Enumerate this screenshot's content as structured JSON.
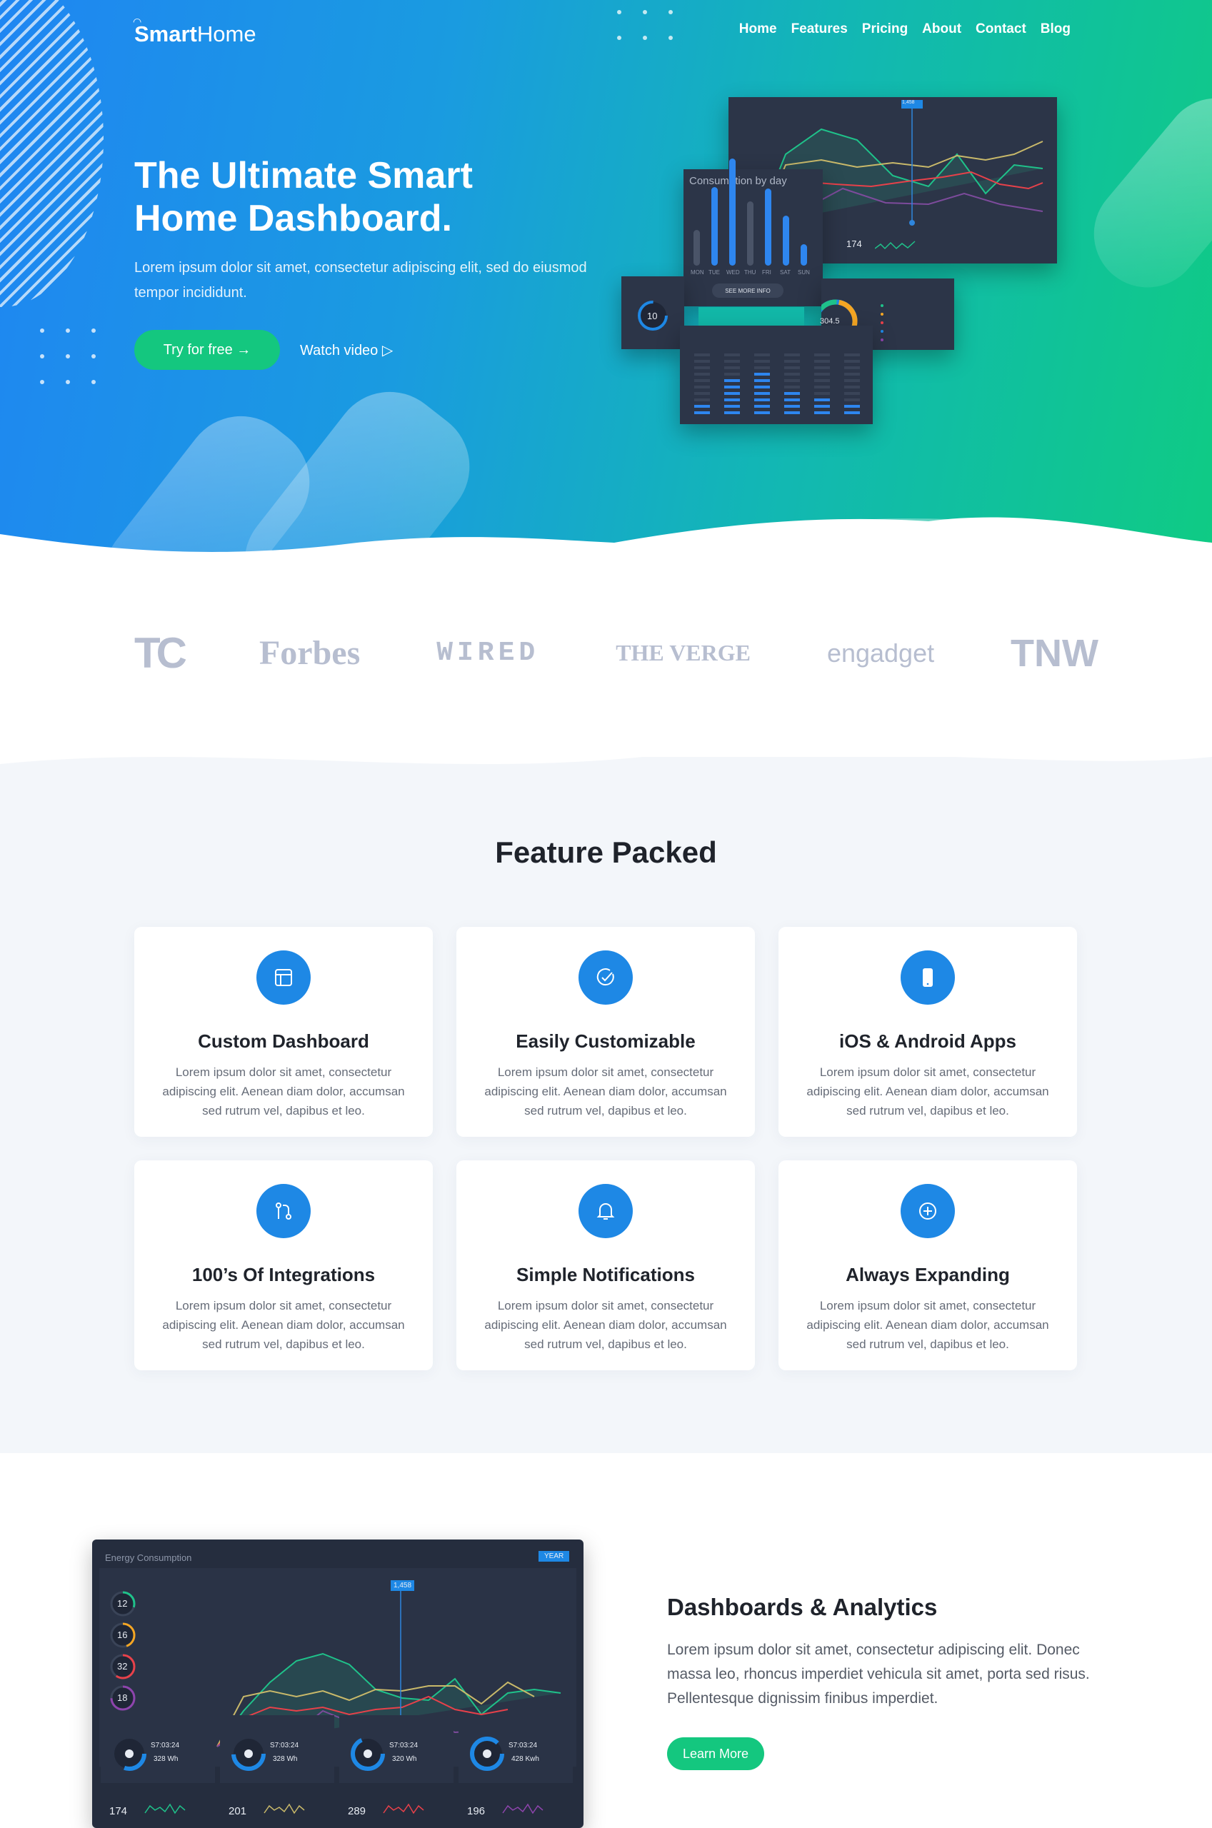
{
  "brand": {
    "bold": "Smart",
    "light": "Home"
  },
  "nav": [
    "Home",
    "Features",
    "Pricing",
    "About",
    "Contact",
    "Blog"
  ],
  "hero": {
    "title_line1": "The Ultimate Smart",
    "title_line2": "Home Dashboard.",
    "subtitle": "Lorem ipsum dolor sit amet, consectetur adipiscing elit, sed do eiusmod tempor incididunt.",
    "cta_primary": "Try for free →",
    "cta_secondary": "Watch video ▷"
  },
  "hero_dash": {
    "consumption_title": "Consumption by day",
    "days": [
      "MON",
      "TUE",
      "WED",
      "THU",
      "FRI",
      "SAT",
      "SUN"
    ],
    "see_more": "SEE MORE INFO",
    "gauge_value": "10",
    "donut_value": "304.5",
    "stat_value": "174",
    "marker_label": "1,458"
  },
  "press": [
    "TC",
    "Forbes",
    "WIRED",
    "THE VERGE",
    "engadget",
    "TNW"
  ],
  "features": {
    "title": "Feature Packed",
    "items": [
      {
        "icon": "layout-icon",
        "title": "Custom Dashboard",
        "text": "Lorem ipsum dolor sit amet, consectetur adipiscing elit. Aenean diam dolor, accumsan sed rutrum vel, dapibus et leo."
      },
      {
        "icon": "check-circle-icon",
        "title": "Easily Customizable",
        "text": "Lorem ipsum dolor sit amet, consectetur adipiscing elit. Aenean diam dolor, accumsan sed rutrum vel, dapibus et leo."
      },
      {
        "icon": "smartphone-icon",
        "title": "iOS & Android Apps",
        "text": "Lorem ipsum dolor sit amet, consectetur adipiscing elit. Aenean diam dolor, accumsan sed rutrum vel, dapibus et leo."
      },
      {
        "icon": "integration-icon",
        "title": "100’s Of Integrations",
        "text": "Lorem ipsum dolor sit amet, consectetur adipiscing elit. Aenean diam dolor, accumsan sed rutrum vel, dapibus et leo."
      },
      {
        "icon": "bell-icon",
        "title": "Simple Notifications",
        "text": "Lorem ipsum dolor sit amet, consectetur adipiscing elit. Aenean diam dolor, accumsan sed rutrum vel, dapibus et leo."
      },
      {
        "icon": "plus-circle-icon",
        "title": "Always Expanding",
        "text": "Lorem ipsum dolor sit amet, consectetur adipiscing elit. Aenean diam dolor, accumsan sed rutrum vel, dapibus et leo."
      }
    ]
  },
  "analytics": {
    "title": "Dashboards & Analytics",
    "text": "Lorem ipsum dolor sit amet, consectetur adipiscing elit. Donec massa leo, rhoncus imperdiet vehicula sit amet, porta sed risus. Pellentesque dignissim finibus imperdiet.",
    "button": "Learn More"
  },
  "big_dash": {
    "title": "Energy Consumption",
    "tab_active": "YEAR",
    "marker_label": "1,458",
    "rooms": [
      {
        "value": "12",
        "color": "#1fc28a"
      },
      {
        "value": "16",
        "color": "#f5a623"
      },
      {
        "value": "32",
        "color": "#e8414a"
      },
      {
        "value": "18",
        "color": "#8e44ad"
      }
    ],
    "devices": [
      {
        "time": "S7:03:24",
        "energy": "328 Wh"
      },
      {
        "time": "S7:03:24",
        "energy": "328 Wh"
      },
      {
        "time": "S7:03:24",
        "energy": "320 Wh"
      },
      {
        "time": "S7:03:24",
        "energy": "428 Kwh"
      }
    ],
    "stats": [
      {
        "value": "174",
        "color": "#1fc28a"
      },
      {
        "value": "201",
        "color": "#c9b96a"
      },
      {
        "value": "289",
        "color": "#e8414a"
      },
      {
        "value": "196",
        "color": "#8e44ad"
      }
    ]
  },
  "colors": {
    "blue": "#1e88e5",
    "green": "#14c77f",
    "dark_panel": "#2c3548"
  }
}
